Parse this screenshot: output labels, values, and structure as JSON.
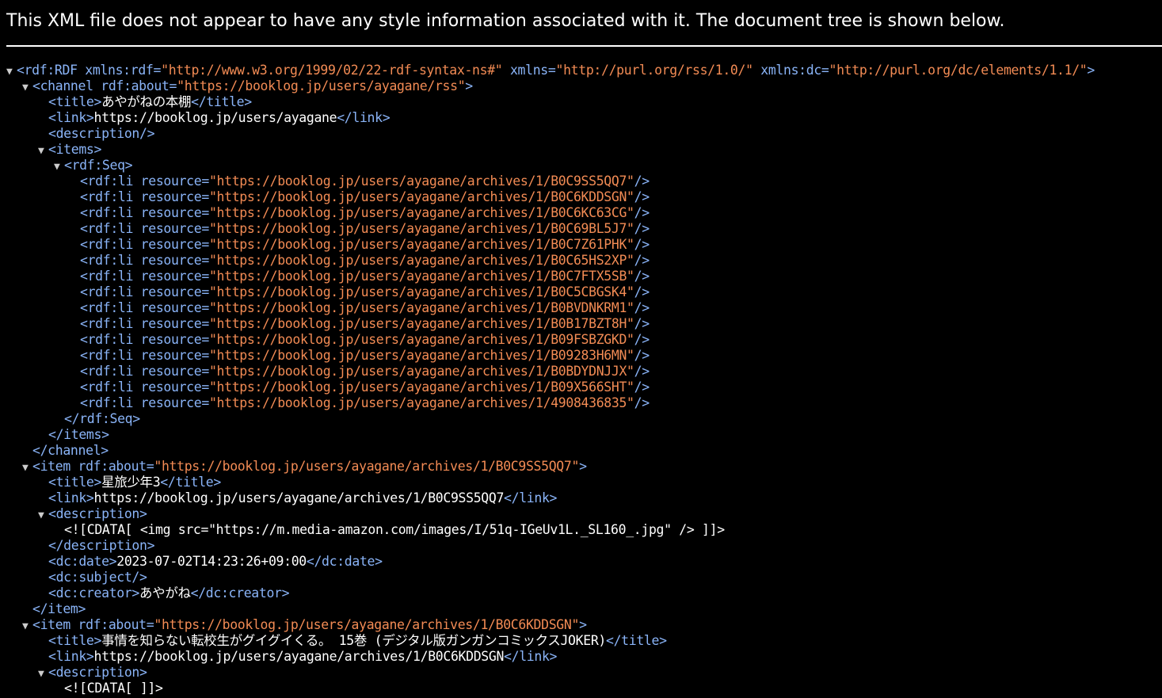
{
  "header": {
    "message": "This XML file does not appear to have any style information associated with it. The document tree is shown below."
  },
  "colors": {
    "tag": "#8ab4f8",
    "value": "#f28b54",
    "text": "#ffffff",
    "background": "#000000"
  },
  "icons": {
    "expanded": "triangle-down-icon"
  },
  "tree": [
    {
      "indent": 0,
      "toggle": true,
      "parts": [
        {
          "k": "tag",
          "t": "<rdf:RDF"
        },
        {
          "k": "attr",
          "t": " xmlns:rdf="
        },
        {
          "k": "val",
          "t": "\"http://www.w3.org/1999/02/22-rdf-syntax-ns#\""
        },
        {
          "k": "attr",
          "t": " xmlns="
        },
        {
          "k": "val",
          "t": "\"http://purl.org/rss/1.0/\""
        },
        {
          "k": "attr",
          "t": " xmlns:dc="
        },
        {
          "k": "val",
          "t": "\"http://purl.org/dc/elements/1.1/\""
        },
        {
          "k": "tag",
          "t": ">"
        }
      ]
    },
    {
      "indent": 1,
      "toggle": true,
      "parts": [
        {
          "k": "tag",
          "t": "<channel"
        },
        {
          "k": "attr",
          "t": " rdf:about="
        },
        {
          "k": "val",
          "t": "\"https://booklog.jp/users/ayagane/rss\""
        },
        {
          "k": "tag",
          "t": ">"
        }
      ]
    },
    {
      "indent": 2,
      "toggle": false,
      "parts": [
        {
          "k": "tag",
          "t": "<title>"
        },
        {
          "k": "txt",
          "t": "あやがねの本棚"
        },
        {
          "k": "tag",
          "t": "</title>"
        }
      ]
    },
    {
      "indent": 2,
      "toggle": false,
      "parts": [
        {
          "k": "tag",
          "t": "<link>"
        },
        {
          "k": "txt",
          "t": "https://booklog.jp/users/ayagane"
        },
        {
          "k": "tag",
          "t": "</link>"
        }
      ]
    },
    {
      "indent": 2,
      "toggle": false,
      "parts": [
        {
          "k": "tag",
          "t": "<description/>"
        }
      ]
    },
    {
      "indent": 2,
      "toggle": true,
      "parts": [
        {
          "k": "tag",
          "t": "<items>"
        }
      ]
    },
    {
      "indent": 3,
      "toggle": true,
      "parts": [
        {
          "k": "tag",
          "t": "<rdf:Seq>"
        }
      ]
    },
    {
      "indent": 4,
      "toggle": false,
      "parts": [
        {
          "k": "tag",
          "t": "<rdf:li"
        },
        {
          "k": "attr",
          "t": " resource="
        },
        {
          "k": "val",
          "t": "\"https://booklog.jp/users/ayagane/archives/1/B0C9SS5QQ7\""
        },
        {
          "k": "tag",
          "t": "/>"
        }
      ]
    },
    {
      "indent": 4,
      "toggle": false,
      "parts": [
        {
          "k": "tag",
          "t": "<rdf:li"
        },
        {
          "k": "attr",
          "t": " resource="
        },
        {
          "k": "val",
          "t": "\"https://booklog.jp/users/ayagane/archives/1/B0C6KDDSGN\""
        },
        {
          "k": "tag",
          "t": "/>"
        }
      ]
    },
    {
      "indent": 4,
      "toggle": false,
      "parts": [
        {
          "k": "tag",
          "t": "<rdf:li"
        },
        {
          "k": "attr",
          "t": " resource="
        },
        {
          "k": "val",
          "t": "\"https://booklog.jp/users/ayagane/archives/1/B0C6KC63CG\""
        },
        {
          "k": "tag",
          "t": "/>"
        }
      ]
    },
    {
      "indent": 4,
      "toggle": false,
      "parts": [
        {
          "k": "tag",
          "t": "<rdf:li"
        },
        {
          "k": "attr",
          "t": " resource="
        },
        {
          "k": "val",
          "t": "\"https://booklog.jp/users/ayagane/archives/1/B0C69BL5J7\""
        },
        {
          "k": "tag",
          "t": "/>"
        }
      ]
    },
    {
      "indent": 4,
      "toggle": false,
      "parts": [
        {
          "k": "tag",
          "t": "<rdf:li"
        },
        {
          "k": "attr",
          "t": " resource="
        },
        {
          "k": "val",
          "t": "\"https://booklog.jp/users/ayagane/archives/1/B0C7Z61PHK\""
        },
        {
          "k": "tag",
          "t": "/>"
        }
      ]
    },
    {
      "indent": 4,
      "toggle": false,
      "parts": [
        {
          "k": "tag",
          "t": "<rdf:li"
        },
        {
          "k": "attr",
          "t": " resource="
        },
        {
          "k": "val",
          "t": "\"https://booklog.jp/users/ayagane/archives/1/B0C65HS2XP\""
        },
        {
          "k": "tag",
          "t": "/>"
        }
      ]
    },
    {
      "indent": 4,
      "toggle": false,
      "parts": [
        {
          "k": "tag",
          "t": "<rdf:li"
        },
        {
          "k": "attr",
          "t": " resource="
        },
        {
          "k": "val",
          "t": "\"https://booklog.jp/users/ayagane/archives/1/B0C7FTX5SB\""
        },
        {
          "k": "tag",
          "t": "/>"
        }
      ]
    },
    {
      "indent": 4,
      "toggle": false,
      "parts": [
        {
          "k": "tag",
          "t": "<rdf:li"
        },
        {
          "k": "attr",
          "t": " resource="
        },
        {
          "k": "val",
          "t": "\"https://booklog.jp/users/ayagane/archives/1/B0C5CBGSK4\""
        },
        {
          "k": "tag",
          "t": "/>"
        }
      ]
    },
    {
      "indent": 4,
      "toggle": false,
      "parts": [
        {
          "k": "tag",
          "t": "<rdf:li"
        },
        {
          "k": "attr",
          "t": " resource="
        },
        {
          "k": "val",
          "t": "\"https://booklog.jp/users/ayagane/archives/1/B0BVDNKRM1\""
        },
        {
          "k": "tag",
          "t": "/>"
        }
      ]
    },
    {
      "indent": 4,
      "toggle": false,
      "parts": [
        {
          "k": "tag",
          "t": "<rdf:li"
        },
        {
          "k": "attr",
          "t": " resource="
        },
        {
          "k": "val",
          "t": "\"https://booklog.jp/users/ayagane/archives/1/B0B17BZT8H\""
        },
        {
          "k": "tag",
          "t": "/>"
        }
      ]
    },
    {
      "indent": 4,
      "toggle": false,
      "parts": [
        {
          "k": "tag",
          "t": "<rdf:li"
        },
        {
          "k": "attr",
          "t": " resource="
        },
        {
          "k": "val",
          "t": "\"https://booklog.jp/users/ayagane/archives/1/B09FSBZGKD\""
        },
        {
          "k": "tag",
          "t": "/>"
        }
      ]
    },
    {
      "indent": 4,
      "toggle": false,
      "parts": [
        {
          "k": "tag",
          "t": "<rdf:li"
        },
        {
          "k": "attr",
          "t": " resource="
        },
        {
          "k": "val",
          "t": "\"https://booklog.jp/users/ayagane/archives/1/B09283H6MN\""
        },
        {
          "k": "tag",
          "t": "/>"
        }
      ]
    },
    {
      "indent": 4,
      "toggle": false,
      "parts": [
        {
          "k": "tag",
          "t": "<rdf:li"
        },
        {
          "k": "attr",
          "t": " resource="
        },
        {
          "k": "val",
          "t": "\"https://booklog.jp/users/ayagane/archives/1/B0BDYDNJJX\""
        },
        {
          "k": "tag",
          "t": "/>"
        }
      ]
    },
    {
      "indent": 4,
      "toggle": false,
      "parts": [
        {
          "k": "tag",
          "t": "<rdf:li"
        },
        {
          "k": "attr",
          "t": " resource="
        },
        {
          "k": "val",
          "t": "\"https://booklog.jp/users/ayagane/archives/1/B09X566SHT\""
        },
        {
          "k": "tag",
          "t": "/>"
        }
      ]
    },
    {
      "indent": 4,
      "toggle": false,
      "parts": [
        {
          "k": "tag",
          "t": "<rdf:li"
        },
        {
          "k": "attr",
          "t": " resource="
        },
        {
          "k": "val",
          "t": "\"https://booklog.jp/users/ayagane/archives/1/4908436835\""
        },
        {
          "k": "tag",
          "t": "/>"
        }
      ]
    },
    {
      "indent": 3,
      "toggle": false,
      "parts": [
        {
          "k": "tag",
          "t": "</rdf:Seq>"
        }
      ]
    },
    {
      "indent": 2,
      "toggle": false,
      "parts": [
        {
          "k": "tag",
          "t": "</items>"
        }
      ]
    },
    {
      "indent": 1,
      "toggle": false,
      "parts": [
        {
          "k": "tag",
          "t": "</channel>"
        }
      ]
    },
    {
      "indent": 1,
      "toggle": true,
      "parts": [
        {
          "k": "tag",
          "t": "<item"
        },
        {
          "k": "attr",
          "t": " rdf:about="
        },
        {
          "k": "val",
          "t": "\"https://booklog.jp/users/ayagane/archives/1/B0C9SS5QQ7\""
        },
        {
          "k": "tag",
          "t": ">"
        }
      ]
    },
    {
      "indent": 2,
      "toggle": false,
      "parts": [
        {
          "k": "tag",
          "t": "<title>"
        },
        {
          "k": "txt",
          "t": "星旅少年3"
        },
        {
          "k": "tag",
          "t": "</title>"
        }
      ]
    },
    {
      "indent": 2,
      "toggle": false,
      "parts": [
        {
          "k": "tag",
          "t": "<link>"
        },
        {
          "k": "txt",
          "t": "https://booklog.jp/users/ayagane/archives/1/B0C9SS5QQ7"
        },
        {
          "k": "tag",
          "t": "</link>"
        }
      ]
    },
    {
      "indent": 2,
      "toggle": true,
      "parts": [
        {
          "k": "tag",
          "t": "<description>"
        }
      ]
    },
    {
      "indent": 3,
      "toggle": false,
      "parts": [
        {
          "k": "txt",
          "t": "<![CDATA[ <img src=\"https://m.media-amazon.com/images/I/51q-IGeUv1L._SL160_.jpg\" /> ]]>"
        }
      ]
    },
    {
      "indent": 2,
      "toggle": false,
      "parts": [
        {
          "k": "tag",
          "t": "</description>"
        }
      ]
    },
    {
      "indent": 2,
      "toggle": false,
      "parts": [
        {
          "k": "tag",
          "t": "<dc:date>"
        },
        {
          "k": "txt",
          "t": "2023-07-02T14:23:26+09:00"
        },
        {
          "k": "tag",
          "t": "</dc:date>"
        }
      ]
    },
    {
      "indent": 2,
      "toggle": false,
      "parts": [
        {
          "k": "tag",
          "t": "<dc:subject/>"
        }
      ]
    },
    {
      "indent": 2,
      "toggle": false,
      "parts": [
        {
          "k": "tag",
          "t": "<dc:creator>"
        },
        {
          "k": "txt",
          "t": "あやがね"
        },
        {
          "k": "tag",
          "t": "</dc:creator>"
        }
      ]
    },
    {
      "indent": 1,
      "toggle": false,
      "parts": [
        {
          "k": "tag",
          "t": "</item>"
        }
      ]
    },
    {
      "indent": 1,
      "toggle": true,
      "parts": [
        {
          "k": "tag",
          "t": "<item"
        },
        {
          "k": "attr",
          "t": " rdf:about="
        },
        {
          "k": "val",
          "t": "\"https://booklog.jp/users/ayagane/archives/1/B0C6KDDSGN\""
        },
        {
          "k": "tag",
          "t": ">"
        }
      ]
    },
    {
      "indent": 2,
      "toggle": false,
      "parts": [
        {
          "k": "tag",
          "t": "<title>"
        },
        {
          "k": "txt",
          "t": "事情を知らない転校生がグイグイくる。 15巻 (デジタル版ガンガンコミックスJOKER)"
        },
        {
          "k": "tag",
          "t": "</title>"
        }
      ]
    },
    {
      "indent": 2,
      "toggle": false,
      "parts": [
        {
          "k": "tag",
          "t": "<link>"
        },
        {
          "k": "txt",
          "t": "https://booklog.jp/users/ayagane/archives/1/B0C6KDDSGN"
        },
        {
          "k": "tag",
          "t": "</link>"
        }
      ]
    },
    {
      "indent": 2,
      "toggle": true,
      "parts": [
        {
          "k": "tag",
          "t": "<description>"
        }
      ]
    },
    {
      "indent": 3,
      "toggle": false,
      "parts": [
        {
          "k": "txt",
          "t": "<![CDATA[ ]]>"
        }
      ]
    }
  ]
}
